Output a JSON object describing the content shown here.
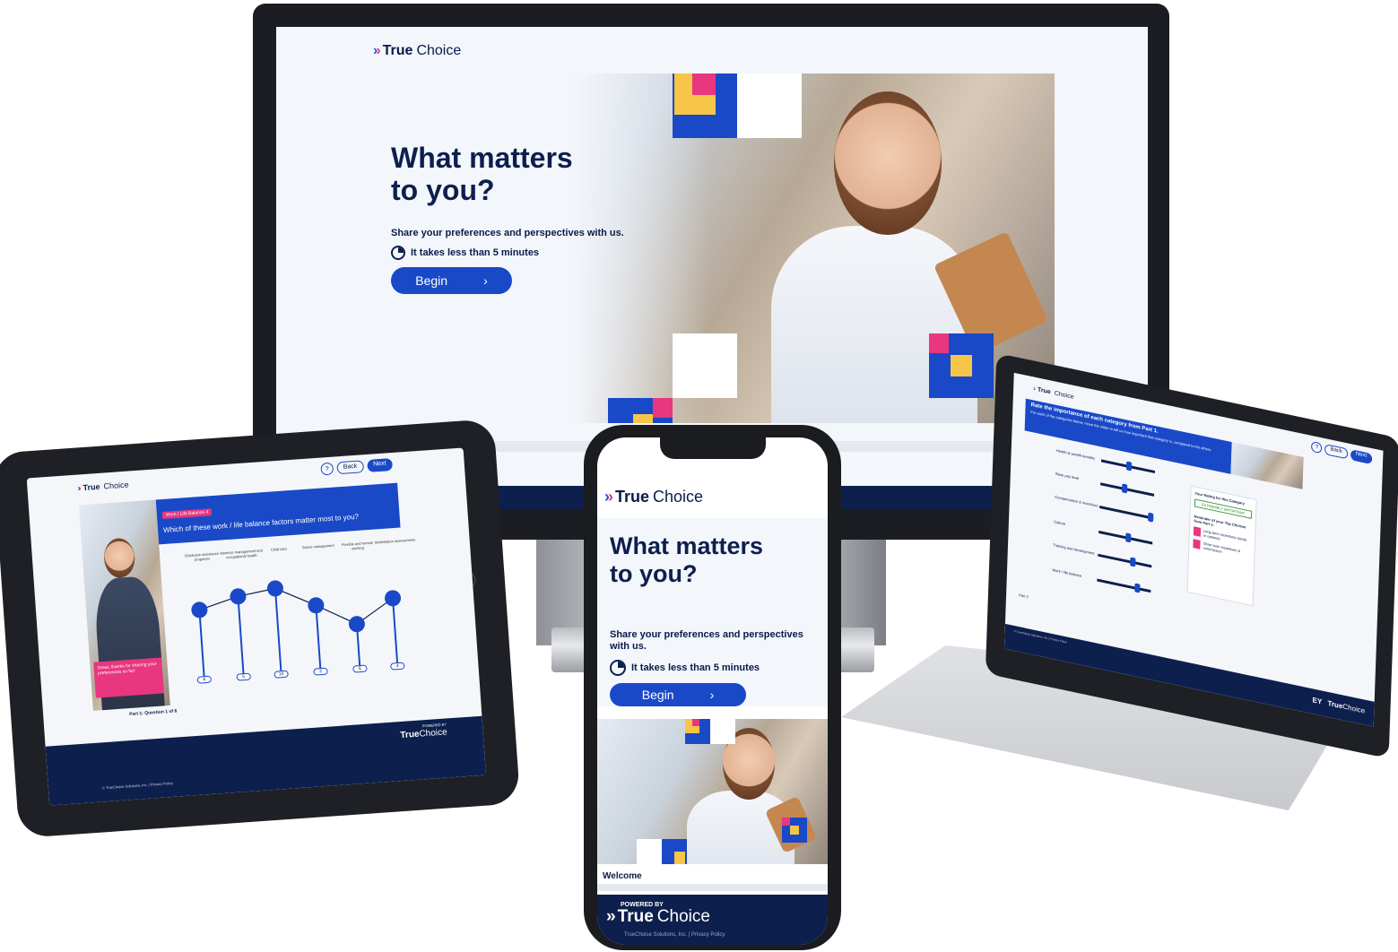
{
  "brand": {
    "name_bold": "True",
    "name_light": "Choice",
    "powered_by": "POWERED BY",
    "ey": "EY"
  },
  "hero": {
    "title_line1": "What matters",
    "title_line2": "to you?",
    "subtitle": "Share your preferences and perspectives with us.",
    "time_note": "It takes less than 5 minutes",
    "begin_label": "Begin",
    "footer_label": "Welcome"
  },
  "tablet": {
    "back_label": "Back",
    "next_label": "Next",
    "help_label": "?",
    "tag_label": "Work / Life Balance",
    "tag_count": "4",
    "question": "Which of these work / life balance factors matter most to you?",
    "factors": [
      {
        "label": "Employee assistance programs",
        "value": "6"
      },
      {
        "label": "Absence management and occupational health",
        "value": "5"
      },
      {
        "label": "Child care",
        "value": "10"
      },
      {
        "label": "Stress management",
        "value": "3"
      },
      {
        "label": "Flexible and remote working",
        "value": "6"
      },
      {
        "label": "Workstation assessments",
        "value": "4"
      }
    ],
    "toast": "Great, thanks for sharing your preferences so far!",
    "progress_label": "Part 1: Question 1 of 6",
    "footer": "© TrueChoice Solutions, Inc. | Privacy Policy"
  },
  "laptop": {
    "back_label": "Back",
    "next_label": "Next",
    "help_label": "?",
    "heading": "Rate the importance of each category from Part 1.",
    "subheading": "For each of the categories below, move the slider to tell us how important that category is, compared to the others.",
    "categories": [
      "Health &amp; wealth benefits",
      "Base pay level",
      "Compensation &amp; incentives",
      "Culture",
      "Training and development",
      "Work / life balance"
    ],
    "rating_title": "Your Rating for this Category",
    "rating_value": "EXTREMELY IMPORTANT",
    "reminder_title": "Reminder of your Top Choices from Part 1:",
    "reminder_items": [
      "Long term incentives (stock or options)",
      "Short term incentives & commission"
    ],
    "part_label": "Part 2",
    "footer": "© TrueChoice Solutions, Inc. | Privacy Policy"
  },
  "phone": {
    "footer_text": "TrueChoice Solutions, Inc. | Privacy Policy"
  }
}
